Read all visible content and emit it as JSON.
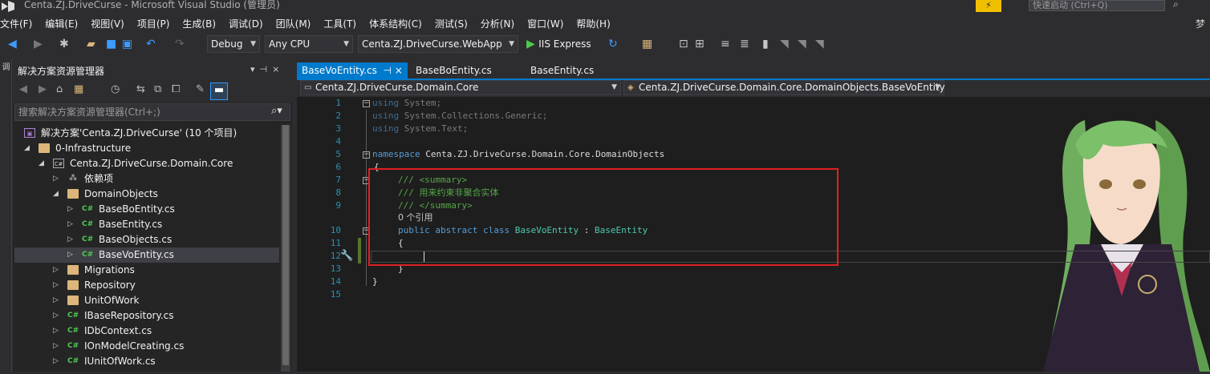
{
  "window": {
    "title": "Centa.ZJ.DriveCurse - Microsoft Visual Studio (管理员)",
    "notification_glyph": "⚡",
    "quick_launch_placeholder": "快速启动 (Ctrl+Q)"
  },
  "menu": {
    "items": [
      "文件(F)",
      "编辑(E)",
      "视图(V)",
      "项目(P)",
      "生成(B)",
      "调试(D)",
      "团队(M)",
      "工具(T)",
      "体系结构(C)",
      "测试(S)",
      "分析(N)",
      "窗口(W)",
      "帮助(H)"
    ],
    "user": "梦"
  },
  "toolbar": {
    "config": "Debug",
    "platform": "Any CPU",
    "startup_project": "Centa.ZJ.DriveCurse.WebApp",
    "run_target": "IIS Express"
  },
  "left_strip": {
    "label": "调"
  },
  "solution_explorer": {
    "title": "解决方案资源管理器",
    "search_placeholder": "搜索解决方案资源管理器(Ctrl+;)",
    "items": [
      {
        "label": "解决方案'Centa.ZJ.DriveCurse' (10 个项目)",
        "icon": "solution-icon"
      },
      {
        "label": "0-Infrastructure",
        "icon": "folder-icon"
      },
      {
        "label": "Centa.ZJ.DriveCurse.Domain.Core",
        "icon": "csproj-icon"
      },
      {
        "label": "依赖项",
        "icon": "dependencies-icon"
      },
      {
        "label": "DomainObjects",
        "icon": "folder-icon"
      },
      {
        "label": "BaseBoEntity.cs",
        "icon": "csharp-file-icon"
      },
      {
        "label": "BaseEntity.cs",
        "icon": "csharp-file-icon"
      },
      {
        "label": "BaseObjects.cs",
        "icon": "csharp-file-icon"
      },
      {
        "label": "BaseVoEntity.cs",
        "icon": "csharp-file-icon",
        "selected": true
      },
      {
        "label": "Migrations",
        "icon": "folder-icon"
      },
      {
        "label": "Repository",
        "icon": "folder-icon"
      },
      {
        "label": "UnitOfWork",
        "icon": "folder-icon"
      },
      {
        "label": "IBaseRepository.cs",
        "icon": "csharp-file-icon"
      },
      {
        "label": "IDbContext.cs",
        "icon": "csharp-file-icon"
      },
      {
        "label": "IOnModelCreating.cs",
        "icon": "csharp-file-icon"
      },
      {
        "label": "IUnitOfWork.cs",
        "icon": "csharp-file-icon"
      }
    ]
  },
  "tabs": [
    {
      "label": "BaseVoEntity.cs",
      "active": true,
      "pin": "⊣ ×"
    },
    {
      "label": "BaseBoEntity.cs"
    },
    {
      "label": "BaseEntity.cs"
    }
  ],
  "navbar": {
    "project": "Centa.ZJ.DriveCurse.Domain.Core",
    "type": "Centa.ZJ.DriveCurse.Domain.Core.DomainObjects.BaseVoEntity"
  },
  "editor": {
    "line_numbers": [
      "1",
      "2",
      "3",
      "4",
      "5",
      "6",
      "7",
      "8",
      "9",
      "",
      "10",
      "11",
      "12",
      "13",
      "14",
      "15"
    ],
    "code": {
      "l1_kw": "using",
      "l1_rest": " System;",
      "l2_kw": "using",
      "l2_rest": " System.Collections.Generic;",
      "l3_kw": "using",
      "l3_rest": " System.Text;",
      "l5_kw": "namespace",
      "l5_rest": " Centa.ZJ.DriveCurse.Domain.Core.DomainObjects",
      "l6": "{",
      "l7": "/// <summary>",
      "l8": "/// 用来约束非聚合实体",
      "l9": "/// </summary>",
      "refs": "0 个引用",
      "l10_kw": "public abstract class",
      "l10_name": " BaseVoEntity",
      "l10_sep": " : ",
      "l10_base": "BaseEntity",
      "l11": "{",
      "l13": "}",
      "l14": "}"
    }
  }
}
